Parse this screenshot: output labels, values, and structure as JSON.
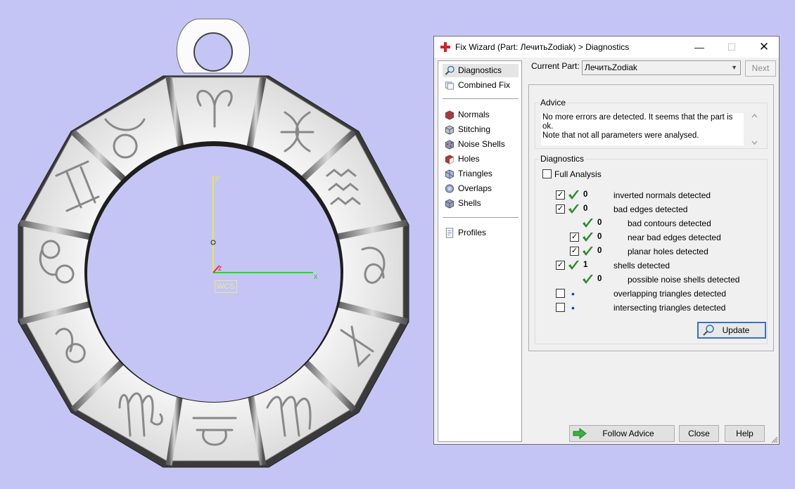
{
  "viewport": {
    "axis_y": "y",
    "axis_x": "x",
    "axis_z": "z",
    "wcs_label": "WCS"
  },
  "dialog": {
    "title": "Fix Wizard (Part: ЛечитьZodiak) > Diagnostics",
    "nav": {
      "group1": [
        "Diagnostics",
        "Combined Fix"
      ],
      "group2": [
        "Normals",
        "Stitching",
        "Noise Shells",
        "Holes",
        "Triangles",
        "Overlaps",
        "Shells"
      ],
      "group3": [
        "Profiles"
      ],
      "selected": "Diagnostics"
    },
    "current_part_label": "Current Part:",
    "current_part_value": "ЛечитьZodiak",
    "next_label": "Next",
    "advice": {
      "title": "Advice",
      "text_line1": "No more errors are detected. It seems that the part is ok.",
      "text_line2": "Note that not all parameters were analysed."
    },
    "diagnostics": {
      "title": "Diagnostics",
      "full_analysis_label": "Full Analysis",
      "full_analysis_checked": false,
      "rows": [
        {
          "checked": true,
          "status": "ok",
          "count": "0",
          "label": "inverted normals detected"
        },
        {
          "checked": true,
          "status": "ok",
          "count": "0",
          "label": "bad edges detected"
        },
        {
          "checked": null,
          "status": "ok",
          "count": "0",
          "label": "bad contours detected"
        },
        {
          "checked": true,
          "status": "ok",
          "count": "0",
          "label": "near bad edges detected"
        },
        {
          "checked": true,
          "status": "ok",
          "count": "0",
          "label": "planar holes detected"
        },
        {
          "checked": true,
          "status": "ok",
          "count": "1",
          "label": "shells detected"
        },
        {
          "checked": null,
          "status": "ok",
          "count": "0",
          "label": "possible noise shells detected"
        },
        {
          "checked": false,
          "status": "pending",
          "count": "",
          "label": "overlapping triangles detected"
        },
        {
          "checked": false,
          "status": "pending",
          "count": "",
          "label": "intersecting triangles detected"
        }
      ],
      "update_label": "Update"
    },
    "buttons": {
      "follow_advice": "Follow Advice",
      "close": "Close",
      "help": "Help"
    },
    "colors": {
      "ok_check": "#2e8b2e",
      "accent": "#3a71c4",
      "viewport_bg": "#c5c5f5"
    }
  }
}
